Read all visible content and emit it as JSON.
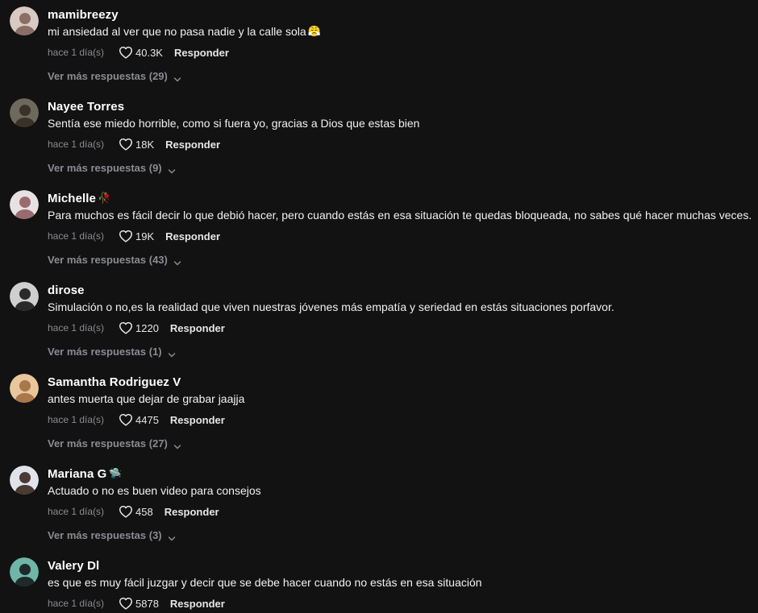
{
  "comments": [
    {
      "username": "mamibreezy",
      "emoji": "😤",
      "emoji_position": "text",
      "text": "mi ansiedad al ver que no pasa nadie y la calle sola",
      "time": "hace 1 día(s)",
      "likes": "40.3K",
      "reply_label": "Responder",
      "more_replies": "Ver más respuestas (29)",
      "avatar_colors": [
        "#d9c9c4",
        "#8b6f66"
      ]
    },
    {
      "username": "Nayee Torres",
      "emoji": "",
      "emoji_position": "",
      "text": "Sentía ese miedo horrible, como si fuera yo, gracias a Dios que estas bien",
      "time": "hace 1 día(s)",
      "likes": "18K",
      "reply_label": "Responder",
      "more_replies": "Ver más respuestas (9)",
      "avatar_colors": [
        "#6d6a5d",
        "#3a3128"
      ]
    },
    {
      "username": "Michelle",
      "emoji": "🥀",
      "emoji_position": "name",
      "text": "Para muchos es fácil decir lo que debió hacer, pero cuando estás en esa situación te quedas bloqueada, no sabes qué hacer muchas veces.",
      "time": "hace 1 día(s)",
      "likes": "19K",
      "reply_label": "Responder",
      "more_replies": "Ver más respuestas (43)",
      "avatar_colors": [
        "#e8e1e3",
        "#9a6b6e"
      ]
    },
    {
      "username": "dirose",
      "emoji": "",
      "emoji_position": "",
      "text": "Simulación o no,es la realidad que viven nuestras jóvenes más empatía y seriedad en estás situaciones porfavor.",
      "time": "hace 1 día(s)",
      "likes": "1220",
      "reply_label": "Responder",
      "more_replies": "Ver más respuestas (1)",
      "avatar_colors": [
        "#cfcfcf",
        "#2a2a2a"
      ]
    },
    {
      "username": "Samantha Rodriguez V",
      "emoji": "",
      "emoji_position": "",
      "text": "antes muerta que dejar de grabar jaajja",
      "time": "hace 1 día(s)",
      "likes": "4475",
      "reply_label": "Responder",
      "more_replies": "Ver más respuestas (27)",
      "avatar_colors": [
        "#e7c79b",
        "#a9774a"
      ]
    },
    {
      "username": "Mariana G",
      "emoji": "🛸",
      "emoji_position": "name",
      "text": "Actuado o no es buen video para consejos",
      "time": "hace 1 día(s)",
      "likes": "458",
      "reply_label": "Responder",
      "more_replies": "Ver más respuestas (3)",
      "avatar_colors": [
        "#dfe4ea",
        "#4a3a33"
      ]
    },
    {
      "username": "Valery Dl",
      "emoji": "",
      "emoji_position": "",
      "text": "es que es muy fácil juzgar y decir que se debe hacer cuando no estás en esa situación",
      "time": "hace 1 día(s)",
      "likes": "5878",
      "reply_label": "Responder",
      "more_replies": "",
      "avatar_colors": [
        "#6fb5a8",
        "#1e2a2a"
      ]
    }
  ]
}
